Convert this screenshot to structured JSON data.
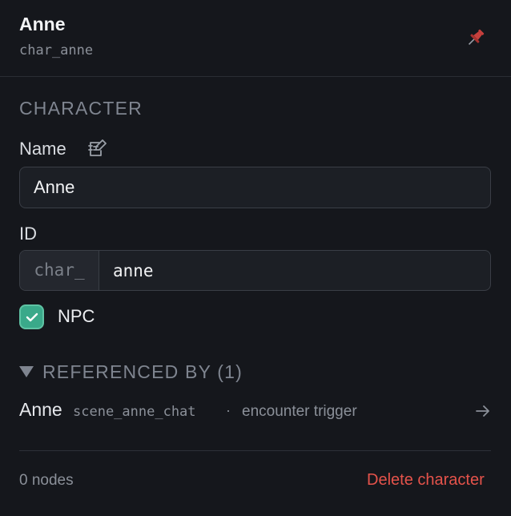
{
  "header": {
    "title": "Anne",
    "subtitle": "char_anne",
    "pin_icon": "pin-icon",
    "pin_color": "#c7403d"
  },
  "character": {
    "section_title": "CHARACTER",
    "name_label": "Name",
    "name_value": "Anne",
    "edit_icon": "edit-notes-icon",
    "id_label": "ID",
    "id_prefix": "char_",
    "id_value": "anne",
    "npc_label": "NPC",
    "npc_checked": true,
    "check_color": "#3aa98a"
  },
  "references": {
    "title": "REFERENCED BY (1)",
    "expanded": true,
    "items": [
      {
        "name": "Anne",
        "scene": "scene_anne_chat",
        "separator": "·",
        "type": "encounter trigger",
        "arrow_icon": "arrow-right-icon"
      }
    ]
  },
  "footer": {
    "node_count": "0 nodes",
    "delete_label": "Delete character",
    "delete_color": "#e5534b"
  }
}
